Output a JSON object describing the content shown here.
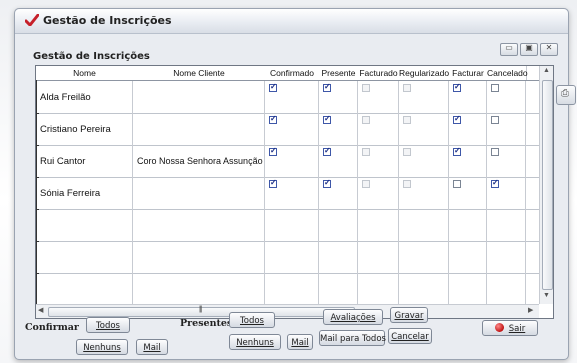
{
  "window": {
    "title": "Gestão de Inscrições",
    "controls": [
      "minimize",
      "restore",
      "close"
    ]
  },
  "group": {
    "label": "Gestão de Inscrições"
  },
  "grid": {
    "columns": [
      "Nome",
      "Nome Cliente",
      "Confirmado",
      "Presente",
      "Facturado",
      "Regularizado",
      "Facturar",
      "Cancelado"
    ],
    "rows": [
      {
        "nome": "Alda Freilão",
        "cliente": "",
        "checks": [
          true,
          true,
          false,
          false,
          true,
          false
        ]
      },
      {
        "nome": "Cristiano Pereira",
        "cliente": "",
        "checks": [
          true,
          true,
          false,
          false,
          true,
          false
        ]
      },
      {
        "nome": "Rui Cantor",
        "cliente": "Coro Nossa Senhora Assunção",
        "checks": [
          true,
          true,
          false,
          false,
          true,
          false
        ]
      },
      {
        "nome": "Sónia Ferreira",
        "cliente": "",
        "checks": [
          true,
          true,
          false,
          false,
          false,
          true
        ]
      }
    ],
    "empty_rows": 5
  },
  "bottom": {
    "confirmar_label": "Confirmar",
    "presentes_label": "Presentes",
    "buttons": {
      "confirmar_todos": "Todos",
      "confirmar_nenhuns": "Nenhuns",
      "mail": "Mail",
      "presentes_todos": "Todos",
      "presentes_nenhuns": "Nenhuns",
      "presentes_mail": "Mail",
      "avaliacoes": "Avaliações",
      "mail_para_todos": "Mail para Todos",
      "gravar": "Gravar",
      "cancelar": "Cancelar",
      "sair": "Sair"
    }
  },
  "colors": {
    "check": "#1c2f86",
    "grid_border": "#6f7784",
    "window_bg": "#e9ecf1"
  }
}
